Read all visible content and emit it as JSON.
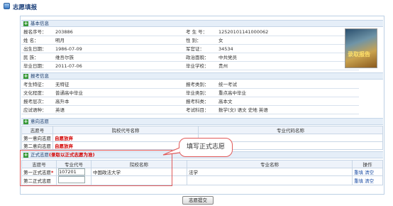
{
  "title": "志愿填报",
  "basic": {
    "section_label": "基本信息",
    "rows": [
      {
        "l1": "报名序号：",
        "v1": "203886",
        "l2": "考 生 号：",
        "v2": "12520101141000062"
      },
      {
        "l1": "姓    名：",
        "v1": "明月",
        "l2": "性    别：",
        "v2": "女"
      },
      {
        "l1": "出生日期：",
        "v1": "1986-07-09",
        "l2": "军官证：",
        "v2": "34534"
      },
      {
        "l1": "民    族：",
        "v1": "维吾尔族",
        "l2": "政治面貌：",
        "v2": "中共党员"
      },
      {
        "l1": "毕业日期：",
        "v1": "2011-07-06",
        "l2": "毕业学校：",
        "v2": "贵州"
      }
    ],
    "photo_text": "录取报告"
  },
  "exam": {
    "section_label": "报考信息",
    "rows": [
      {
        "l1": "考生特征：",
        "v1": "无特征",
        "l2": "报考类别：",
        "v2": "统一考试"
      },
      {
        "l1": "文化程度：",
        "v1": "普通高中毕业",
        "l2": "毕业类别：",
        "v2": "重点高中毕业"
      },
      {
        "l1": "报考层次：",
        "v1": "高升本",
        "l2": "报考科类：",
        "v2": "高本文"
      },
      {
        "l1": "应试语种：",
        "v1": "英语",
        "l2": "考试科目：",
        "v2": "数学(文)  语文  史地  英语"
      }
    ]
  },
  "intent": {
    "section_label": "意向志愿",
    "headers": [
      "志愿号",
      "院校代号名称",
      "专业代码名称"
    ],
    "rows": [
      {
        "no": "第一意向志愿",
        "school": "自愿放弃"
      },
      {
        "no": "第二意向志愿",
        "school": "自愿放弃"
      }
    ]
  },
  "formal": {
    "section_label": "正式志愿",
    "section_note": "(录取以正式志愿为准)",
    "headers": [
      "志愿号",
      "专业代号",
      "院校名称",
      "专业名称",
      "操作"
    ],
    "rows": [
      {
        "no": "第一正式志愿",
        "req": "*",
        "code": "107201",
        "school": "中国政法大学",
        "major": "法学",
        "op1": "重填",
        "op2": "清空"
      },
      {
        "no": "第二正式志愿",
        "req": "",
        "code": "",
        "school": "",
        "major": "",
        "op1": "重填",
        "op2": "清空"
      }
    ]
  },
  "callout": "填写正式志愿",
  "submit_label": "志愿提交"
}
